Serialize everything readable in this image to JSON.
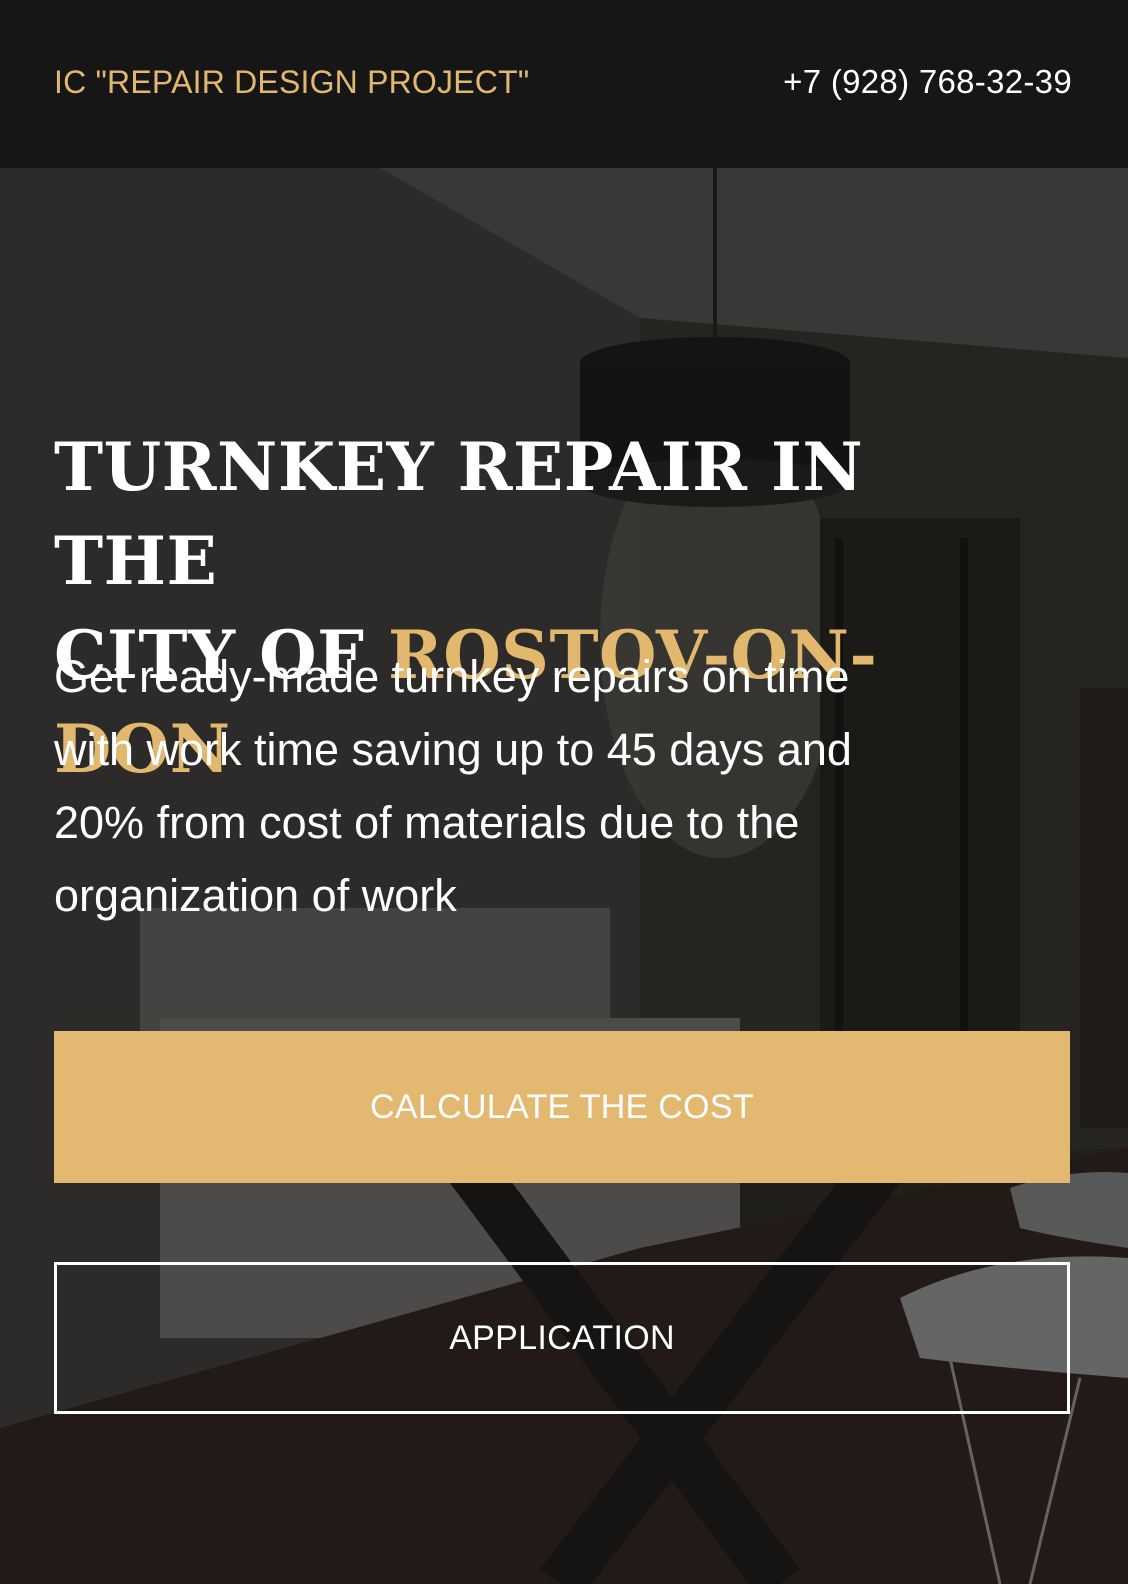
{
  "header": {
    "brand": "IC \"REPAIR DESIGN PROJECT\"",
    "phone": "+7 (928) 768-32-39"
  },
  "hero": {
    "title_line1": "TURNKEY REPAIR IN THE",
    "title_line2_prefix": "CITY OF ",
    "title_accent": "ROSTOV-ON-DON",
    "subtitle": "Get ready-made turnkey repairs on time with work time saving up to 45 days and 20% from cost of materials due to the organization of work",
    "calculate_button": "CALCULATE THE COST",
    "application_button": "APPLICATION"
  },
  "colors": {
    "accent": "#e2b86f",
    "header_bg": "#161616",
    "text": "#ffffff"
  }
}
